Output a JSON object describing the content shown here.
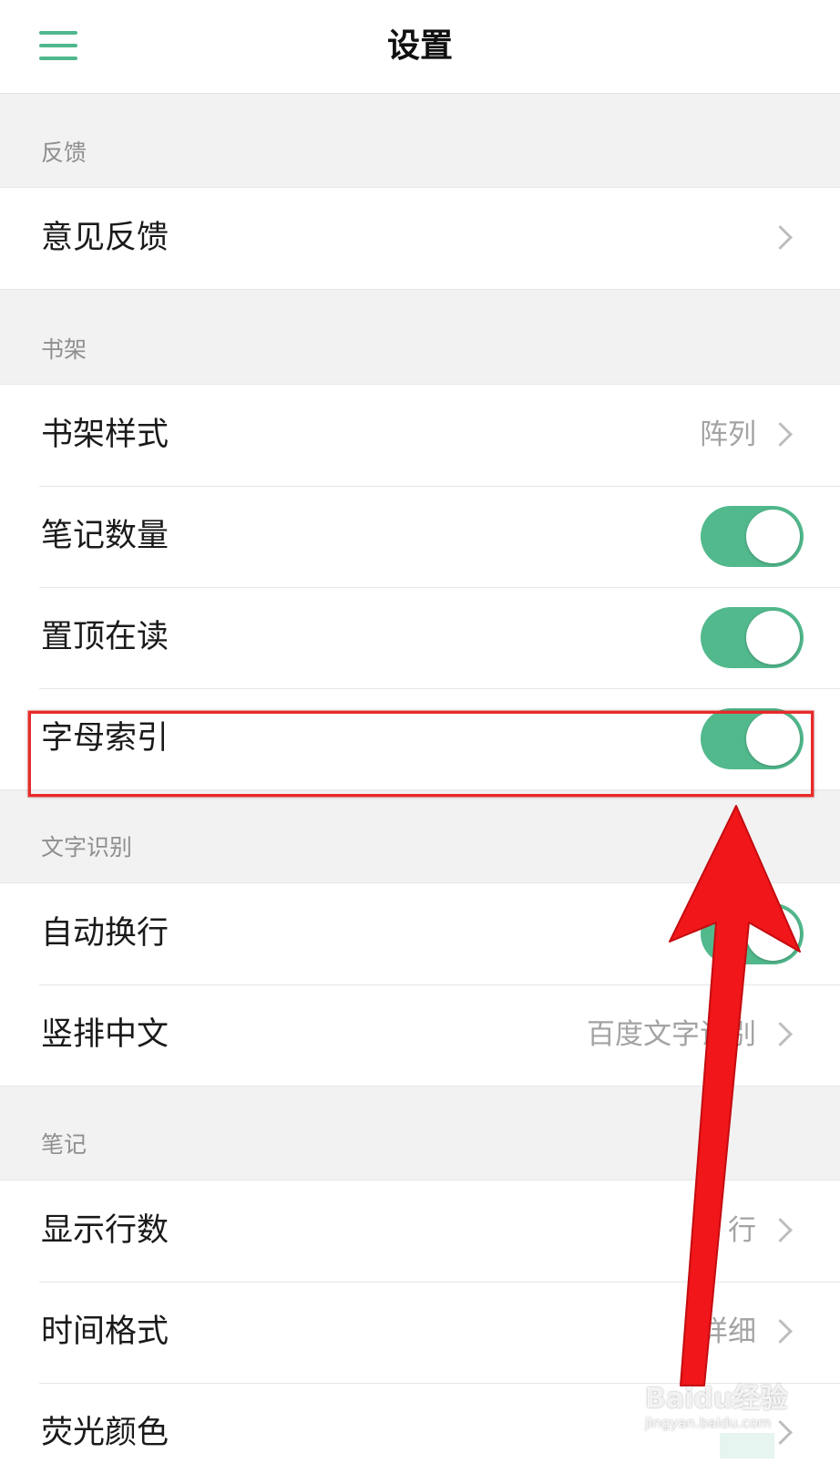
{
  "header": {
    "title": "设置",
    "menu_icon": "hamburger-menu-icon"
  },
  "colors": {
    "accent": "#52b98d",
    "annotation": "#e82a2a"
  },
  "sections": {
    "feedback": {
      "label": "反馈",
      "rows": [
        {
          "label": "意见反馈",
          "type": "link"
        }
      ]
    },
    "bookshelf": {
      "label": "书架",
      "rows": [
        {
          "label": "书架样式",
          "type": "link",
          "value": "阵列"
        },
        {
          "label": "笔记数量",
          "type": "toggle",
          "on": true
        },
        {
          "label": "置顶在读",
          "type": "toggle",
          "on": true
        },
        {
          "label": "字母索引",
          "type": "toggle",
          "on": true
        }
      ]
    },
    "ocr": {
      "label": "文字识别",
      "rows": [
        {
          "label": "自动换行",
          "type": "toggle",
          "on": true
        },
        {
          "label": "竖排中文",
          "type": "link",
          "value": "百度文字识别"
        }
      ]
    },
    "notes": {
      "label": "笔记",
      "rows": [
        {
          "label": "显示行数",
          "type": "link",
          "value": "3 行"
        },
        {
          "label": "时间格式",
          "type": "link",
          "value": "详细"
        },
        {
          "label": "荧光颜色",
          "type": "link"
        }
      ]
    }
  },
  "watermark": {
    "brand": "Baidu经验",
    "url": "jingyan.baidu.com"
  }
}
